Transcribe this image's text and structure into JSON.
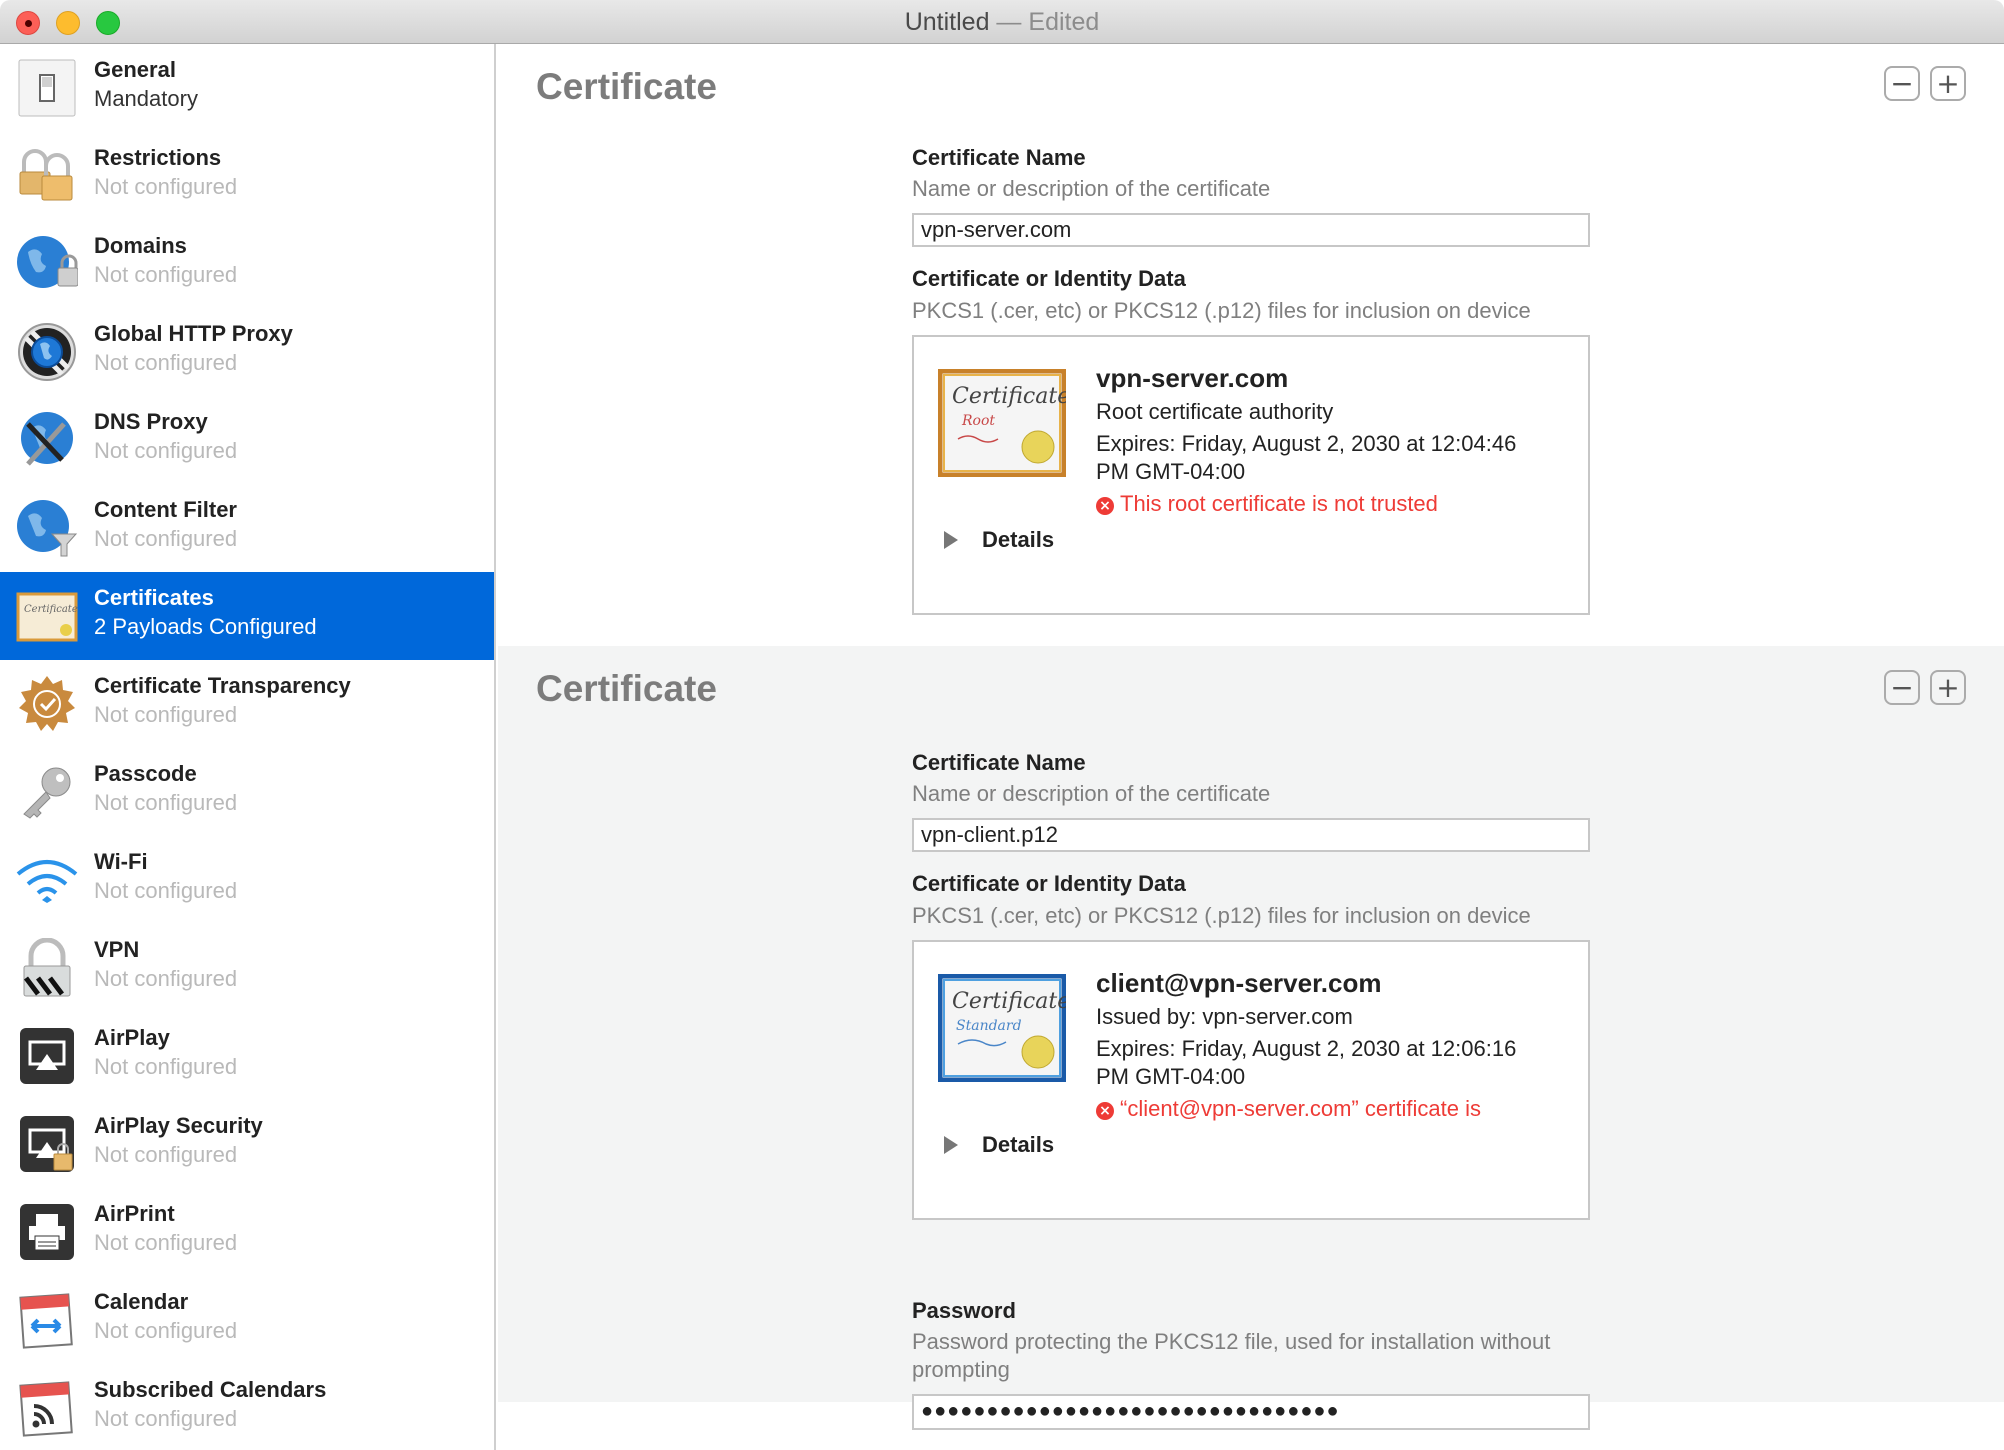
{
  "window": {
    "title": "Untitled",
    "separator": " — ",
    "status": "Edited"
  },
  "sidebar": {
    "items": [
      {
        "title": "General",
        "subtitle": "Mandatory",
        "icon": "switch-icon"
      },
      {
        "title": "Restrictions",
        "subtitle": "Not configured",
        "icon": "padlocks-icon"
      },
      {
        "title": "Domains",
        "subtitle": "Not configured",
        "icon": "globe-lock-icon"
      },
      {
        "title": "Global HTTP Proxy",
        "subtitle": "Not configured",
        "icon": "proxy-globe-icon"
      },
      {
        "title": "DNS Proxy",
        "subtitle": "Not configured",
        "icon": "globe-tools-icon"
      },
      {
        "title": "Content Filter",
        "subtitle": "Not configured",
        "icon": "globe-funnel-icon"
      },
      {
        "title": "Certificates",
        "subtitle": "2 Payloads Configured",
        "icon": "certificate-icon",
        "selected": true
      },
      {
        "title": "Certificate Transparency",
        "subtitle": "Not configured",
        "icon": "seal-check-icon"
      },
      {
        "title": "Passcode",
        "subtitle": "Not configured",
        "icon": "key-icon"
      },
      {
        "title": "Wi-Fi",
        "subtitle": "Not configured",
        "icon": "wifi-icon"
      },
      {
        "title": "VPN",
        "subtitle": "Not configured",
        "icon": "vpn-lock-icon"
      },
      {
        "title": "AirPlay",
        "subtitle": "Not configured",
        "icon": "airplay-icon"
      },
      {
        "title": "AirPlay Security",
        "subtitle": "Not configured",
        "icon": "airplay-lock-icon"
      },
      {
        "title": "AirPrint",
        "subtitle": "Not configured",
        "icon": "printer-icon"
      },
      {
        "title": "Calendar",
        "subtitle": "Not configured",
        "icon": "calendar-sync-icon"
      },
      {
        "title": "Subscribed Calendars",
        "subtitle": "Not configured",
        "icon": "calendar-rss-icon"
      }
    ]
  },
  "payloads": [
    {
      "section_title": "Certificate",
      "remove_label": "−",
      "add_label": "+",
      "name_label": "Certificate Name",
      "name_desc": "Name or description of the certificate",
      "name_value": "vpn-server.com",
      "data_label": "Certificate or Identity Data",
      "data_desc": "PKCS1 (.cer, etc) or PKCS12 (.p12) files for inclusion on device",
      "cert": {
        "image_title": "Certificate",
        "image_kind": "Root",
        "name": "vpn-server.com",
        "line1": "Root certificate authority",
        "expires_1": "Expires: Friday, August 2, 2030 at 12:04:46",
        "expires_2": "PM GMT-04:00",
        "error": "This root certificate is not trusted",
        "details_label": "Details"
      }
    },
    {
      "section_title": "Certificate",
      "remove_label": "−",
      "add_label": "+",
      "name_label": "Certificate Name",
      "name_desc": "Name or description of the certificate",
      "name_value": "vpn-client.p12",
      "data_label": "Certificate or Identity Data",
      "data_desc": "PKCS1 (.cer, etc) or PKCS12 (.p12) files for inclusion on device",
      "cert": {
        "image_title": "Certificate",
        "image_kind": "Standard",
        "name": "client@vpn-server.com",
        "line1": "Issued by: vpn-server.com",
        "expires_1": "Expires: Friday, August 2, 2030 at 12:06:16",
        "expires_2": "PM GMT-04:00",
        "error": "“client@vpn-server.com” certificate is",
        "details_label": "Details"
      },
      "password_label": "Password",
      "password_desc": "Password protecting the PKCS12 file, used for installation without prompting",
      "password_value": "●●●●●●●●●●●●●●●●●●●●●●●●●●●●●●●●"
    }
  ],
  "colors": {
    "selection": "#0068da",
    "error": "#ee3b36",
    "alt_section_bg": "#f3f4f4"
  }
}
